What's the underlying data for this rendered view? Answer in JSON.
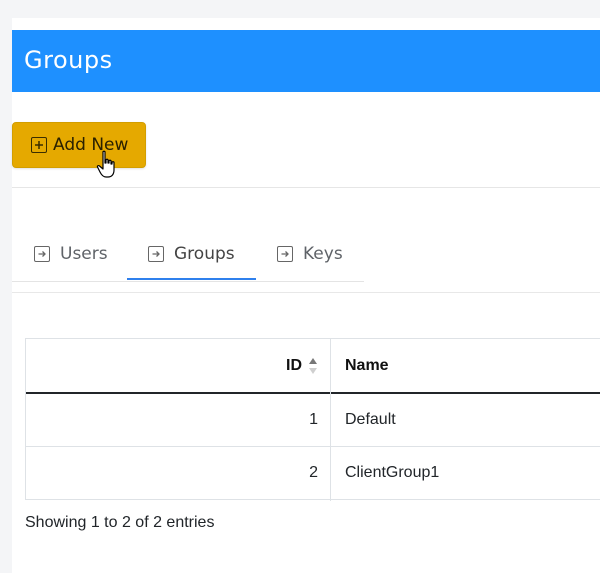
{
  "header": {
    "title": "Groups"
  },
  "toolbar": {
    "add_label": "Add New"
  },
  "tabs": [
    {
      "label": "Users",
      "active": false
    },
    {
      "label": "Groups",
      "active": true
    },
    {
      "label": "Keys",
      "active": false
    }
  ],
  "table": {
    "columns": [
      "ID",
      "Name"
    ],
    "rows": [
      {
        "id": "1",
        "name": "Default"
      },
      {
        "id": "2",
        "name": "ClientGroup1"
      }
    ]
  },
  "footer": {
    "info": "Showing 1 to 2 of 2 entries"
  },
  "colors": {
    "header_bg": "#1e90ff",
    "add_button_bg": "#e5a900",
    "tab_active_underline": "#2f80ed"
  },
  "icons": {
    "add": "plus-square-icon",
    "tab": "arrow-right-square-icon",
    "sort": "sort-up-down-icon",
    "cursor": "hand-pointer-icon"
  }
}
